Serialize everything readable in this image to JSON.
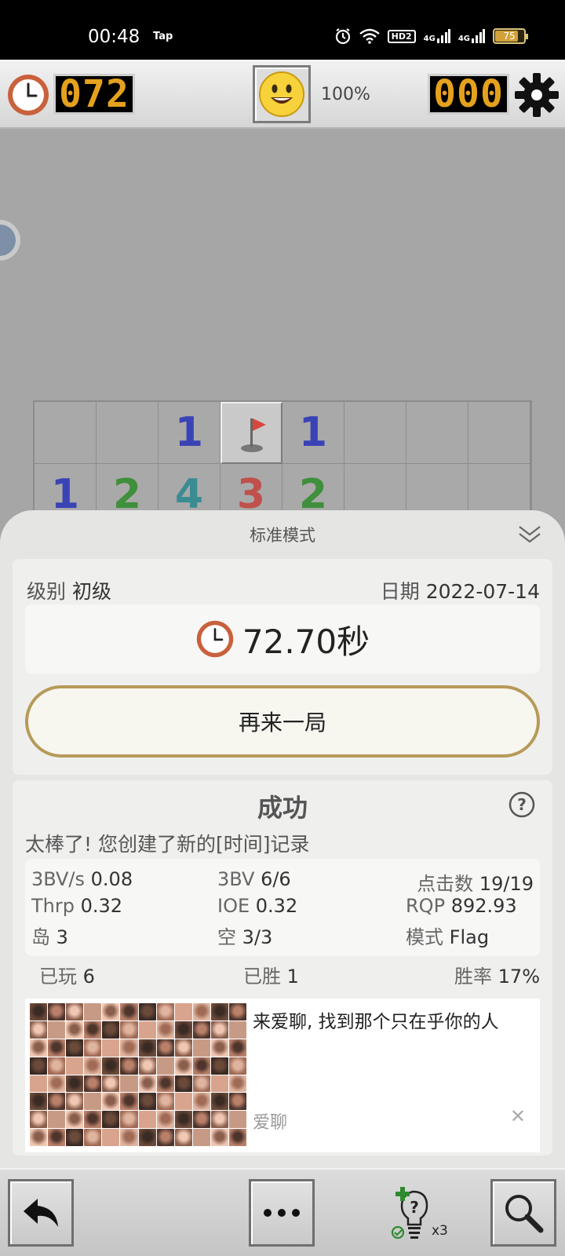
{
  "status_bar": {
    "time": "00:48",
    "app_tag": "Tap",
    "hd": "HD2",
    "net1": "4G",
    "net2": "4G",
    "battery": "75"
  },
  "game_header": {
    "timer": "072",
    "zoom": "100%",
    "mines": "000"
  },
  "board": {
    "cols": 8,
    "cells": [
      {
        "v": "",
        "c": ""
      },
      {
        "v": "",
        "c": ""
      },
      {
        "v": "1",
        "c": "#3a43b5"
      },
      {
        "v": "flag",
        "c": ""
      },
      {
        "v": "1",
        "c": "#3a43b5"
      },
      {
        "v": "",
        "c": ""
      },
      {
        "v": "",
        "c": ""
      },
      {
        "v": "",
        "c": ""
      },
      {
        "v": "1",
        "c": "#3a43b5"
      },
      {
        "v": "2",
        "c": "#3f8f3c"
      },
      {
        "v": "4",
        "c": "#3b8b92"
      },
      {
        "v": "3",
        "c": "#c0504b"
      },
      {
        "v": "2",
        "c": "#3f8f3c"
      },
      {
        "v": "",
        "c": ""
      },
      {
        "v": "",
        "c": ""
      },
      {
        "v": "",
        "c": ""
      }
    ]
  },
  "sheet": {
    "title": "标准模式",
    "level_label": "级别",
    "level_value": "初级",
    "date_label": "日期",
    "date_value": "2022-07-14",
    "time_value": "72.70秒",
    "replay_label": "再来一局",
    "result_title": "成功",
    "record_text": "太棒了! 您创建了新的[时间]记录",
    "stats": {
      "bv_s_label": "3BV/s",
      "bv_s_value": "0.08",
      "bv_label": "3BV",
      "bv_value": "6/6",
      "clicks_label": "点击数",
      "clicks_value": "19/19",
      "thrp_label": "Thrp",
      "thrp_value": "0.32",
      "ioe_label": "IOE",
      "ioe_value": "0.32",
      "rqp_label": "RQP",
      "rqp_value": "892.93",
      "island_label": "岛",
      "island_value": "3",
      "empty_label": "空",
      "empty_value": "3/3",
      "mode_label": "模式",
      "mode_value": "Flag"
    },
    "played_label": "已玩",
    "played_value": "6",
    "won_label": "已胜",
    "won_value": "1",
    "rate_label": "胜率",
    "rate_value": "17%",
    "ad": {
      "text": "来爱聊, 找到那个只在乎你的人",
      "source": "爱聊",
      "close": "✕"
    }
  },
  "toolbar": {
    "hint_count": "x3"
  }
}
